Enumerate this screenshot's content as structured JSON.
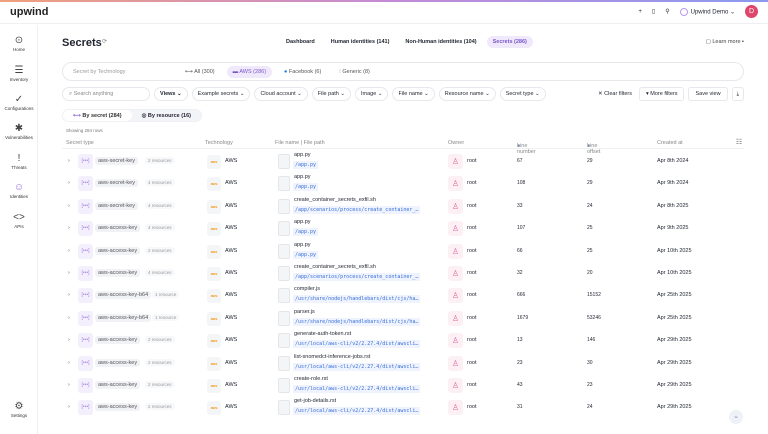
{
  "app": {
    "logo": "upwind",
    "user": "Upwind Demo",
    "avatar_initial": "D",
    "accent": "#7a55c9"
  },
  "sidebar": {
    "items": [
      {
        "label": "Home",
        "icon": "home-icon"
      },
      {
        "label": "Inventory",
        "icon": "list-icon"
      },
      {
        "label": "Configurations",
        "icon": "check-icon"
      },
      {
        "label": "Vulnerabilities",
        "icon": "bug-icon"
      },
      {
        "label": "Threats",
        "icon": "alert-icon"
      },
      {
        "label": "Identities",
        "icon": "user-icon"
      },
      {
        "label": "APIs",
        "icon": "code-icon"
      }
    ],
    "settings": "Settings"
  },
  "header": {
    "title": "Secrets",
    "tabs": [
      "Dashboard",
      "Human identities (141)",
      "Non-Human identities (104)",
      "Secrets (286)"
    ],
    "learn_more": "Learn more"
  },
  "techbar": {
    "placeholder": "Secret by Technology",
    "chips": [
      "All (300)",
      "AWS (286)",
      "Facebook (6)",
      "Generic (8)"
    ]
  },
  "filters": {
    "search_placeholder": "Search anything",
    "buttons": [
      "Views",
      "Example secrets",
      "Cloud account",
      "File path",
      "Image",
      "File name",
      "Resource name",
      "Secret type"
    ],
    "clear": "Clear filters",
    "more": "More filters",
    "save": "Save view"
  },
  "toggle": {
    "by_secret": "By secret (284)",
    "by_resource": "By resource (16)"
  },
  "showing": "Showing 284 rows",
  "columns": [
    "Secret type",
    "Technology",
    "File name | File path",
    "Owner",
    "Line number",
    "Line offset",
    "Created at"
  ],
  "rows": [
    {
      "type": "aws-secret-key",
      "res": "2 resources",
      "tech": "AWS",
      "file": "app.py",
      "path": "/app.py",
      "owner": "root",
      "line": "67",
      "offset": "29",
      "created": "Apr 8th 2024"
    },
    {
      "type": "aws-secret-key",
      "res": "4 resources",
      "tech": "AWS",
      "file": "app.py",
      "path": "/app.py",
      "owner": "root",
      "line": "108",
      "offset": "29",
      "created": "Apr 9th 2024"
    },
    {
      "type": "aws-secret-key",
      "res": "4 resources",
      "tech": "AWS",
      "file": "create_container_secrets_exfil.sh",
      "path": "/app/scenarios/process/create_container_…",
      "owner": "root",
      "line": "33",
      "offset": "24",
      "created": "Apr 8th 2025"
    },
    {
      "type": "aws-access-key",
      "res": "4 resources",
      "tech": "AWS",
      "file": "app.py",
      "path": "/app.py",
      "owner": "root",
      "line": "107",
      "offset": "25",
      "created": "Apr 9th 2025"
    },
    {
      "type": "aws-access-key",
      "res": "2 resources",
      "tech": "AWS",
      "file": "app.py",
      "path": "/app.py",
      "owner": "root",
      "line": "66",
      "offset": "25",
      "created": "Apr 10th 2025"
    },
    {
      "type": "aws-access-key",
      "res": "4 resources",
      "tech": "AWS",
      "file": "create_container_secrets_exfil.sh",
      "path": "/app/scenarios/process/create_container_…",
      "owner": "root",
      "line": "32",
      "offset": "20",
      "created": "Apr 10th 2025"
    },
    {
      "type": "aws-access-key-b64",
      "res": "1 resource",
      "tech": "AWS",
      "file": "compiler.js",
      "path": "/usr/share/nodejs/handlebars/dist/cjs/ha…",
      "owner": "root",
      "line": "666",
      "offset": "15152",
      "created": "Apr 25th 2025"
    },
    {
      "type": "aws-access-key-b64",
      "res": "1 resource",
      "tech": "AWS",
      "file": "parser.js",
      "path": "/usr/share/nodejs/handlebars/dist/cjs/ha…",
      "owner": "root",
      "line": "1679",
      "offset": "53246",
      "created": "Apr 25th 2025"
    },
    {
      "type": "aws-access-key",
      "res": "2 resources",
      "tech": "AWS",
      "file": "generate-auth-token.rst",
      "path": "/usr/local/aws-cli/v2/2.27.4/dist/awscli…",
      "owner": "root",
      "line": "13",
      "offset": "146",
      "created": "Apr 29th 2025"
    },
    {
      "type": "aws-access-key",
      "res": "2 resources",
      "tech": "AWS",
      "file": "list-snomedct-inference-jobs.rst",
      "path": "/usr/local/aws-cli/v2/2.27.4/dist/awscli…",
      "owner": "root",
      "line": "23",
      "offset": "30",
      "created": "Apr 29th 2025"
    },
    {
      "type": "aws-access-key",
      "res": "2 resources",
      "tech": "AWS",
      "file": "create-role.rst",
      "path": "/usr/local/aws-cli/v2/2.27.4/dist/awscli…",
      "owner": "root",
      "line": "43",
      "offset": "23",
      "created": "Apr 29th 2025"
    },
    {
      "type": "aws-access-key",
      "res": "2 resources",
      "tech": "AWS",
      "file": "get-job-details.rst",
      "path": "/usr/local/aws-cli/v2/2.27.4/dist/awscli…",
      "owner": "root",
      "line": "31",
      "offset": "24",
      "created": "Apr 29th 2025"
    }
  ]
}
